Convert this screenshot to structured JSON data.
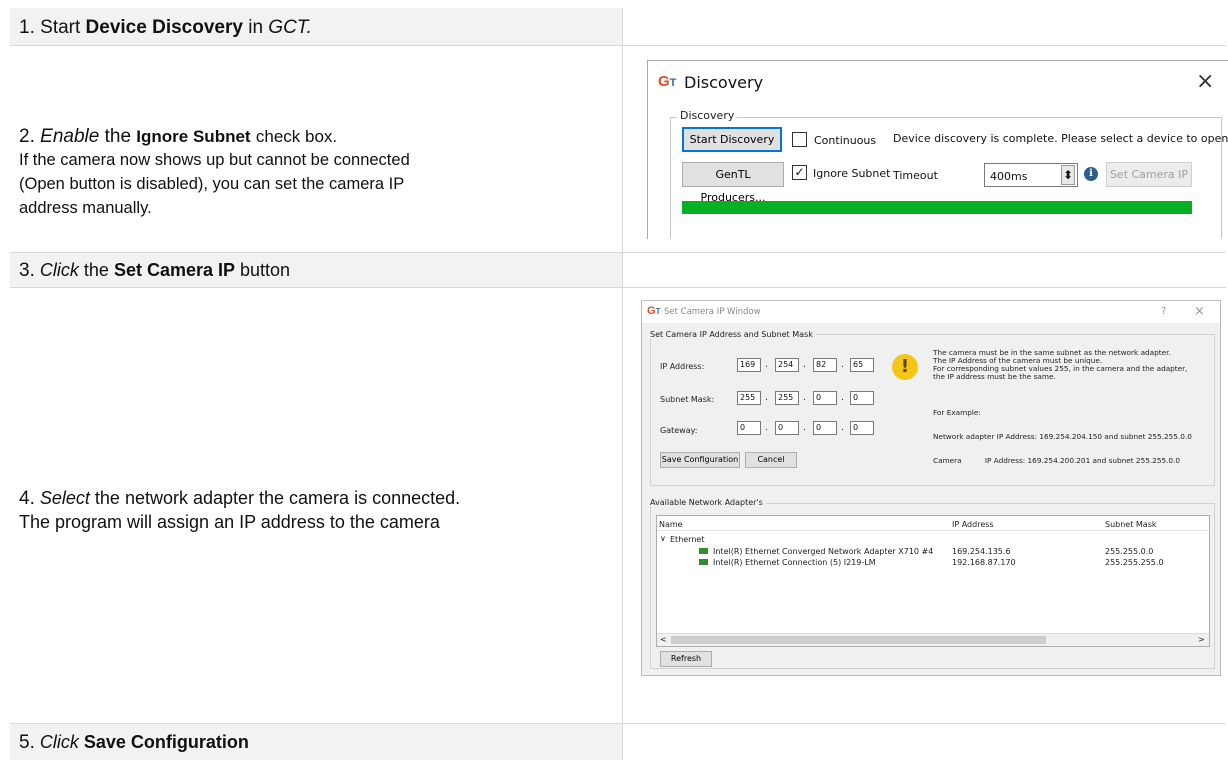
{
  "rows": [
    {
      "number": "1.",
      "text_a": "Start",
      "text_b": "Device Discovery",
      "text_c": "in",
      "text_d": "GCT."
    },
    {
      "number": "2.",
      "verb": "Enable",
      "text_a": "the",
      "text_b": "Ignore Subnet",
      "text_c": "check box.",
      "line2": "If the camera now shows up but cannot be connected",
      "line3": "(Open button is disabled), you can set the camera IP",
      "line4": "address manually."
    },
    {
      "number": "3.",
      "verb": "Click",
      "text_a": "the",
      "text_b": "Set Camera IP",
      "text_c": "button"
    },
    {
      "number": "4.",
      "verb": "Select",
      "text_a": "the network adapter the camera is connected.",
      "line2": "The program will assign an IP address to the camera"
    },
    {
      "number": "5.",
      "verb": "Click",
      "text_b": "Save Configuration"
    }
  ],
  "discovery_dialog": {
    "logo_g": "G",
    "logo_t": "T",
    "title": "Discovery",
    "close": "×",
    "group_label": "Discovery",
    "start_button": "Start Discovery",
    "continuous_label": "Continuous",
    "continuous_checked": false,
    "status": "Device discovery is complete. Please select a device to open.",
    "gentl_button": "GenTL Producers...",
    "ignore_subnet_label": "Ignore Subnet",
    "ignore_subnet_checked": true,
    "check_mark": "✓",
    "timeout_label": "Timeout",
    "timeout_value": "400ms",
    "spin_glyph": "⬍",
    "info_icon": "ℹ",
    "set_ip_button": "Set Camera IP",
    "progress_color": "#06b025"
  },
  "ip_window": {
    "logo_g": "G",
    "logo_t": "T",
    "title": "Set Camera IP Window",
    "help": "?",
    "close": "×",
    "group_label": "Set Camera IP Address and Subnet Mask",
    "ip_label": "IP Address:",
    "ip": [
      "169",
      "254",
      "82",
      "65"
    ],
    "subnet_label": "Subnet Mask:",
    "subnet": [
      "255",
      "255",
      "0",
      "0"
    ],
    "gateway_label": "Gateway:",
    "gateway": [
      "0",
      "0",
      "0",
      "0"
    ],
    "dot": ".",
    "warning_glyph": "!",
    "info_lines": [
      "The camera must be in the same subnet as the network adapter.",
      "The IP Address of the camera must be unique.",
      "For corresponding subnet values 255, in the camera and the adapter,",
      "the IP address must be the same."
    ],
    "example_lines": [
      "For Example:",
      "Network adapter IP Address: 169.254.204.150 and subnet 255.255.0.0",
      "Camera          IP Address: 169.254.200.201 and subnet 255.255.0.0"
    ],
    "save_button": "Save Configuration",
    "cancel_button": "Cancel",
    "adapters_label": "Available Network Adapter's",
    "columns": [
      "Name",
      "IP Address",
      "Subnet Mask"
    ],
    "group_name": "Ethernet",
    "expand_glyph": "∨",
    "adapters": [
      {
        "name": "Intel(R) Ethernet Converged Network Adapter X710 #4",
        "ip": "169.254.135.6",
        "mask": "255.255.0.0"
      },
      {
        "name": "Intel(R) Ethernet Connection (5) I219-LM",
        "ip": "192.168.87.170",
        "mask": "255.255.255.0"
      }
    ],
    "scroll_left": "<",
    "scroll_right": ">",
    "refresh_button": "Refresh"
  }
}
